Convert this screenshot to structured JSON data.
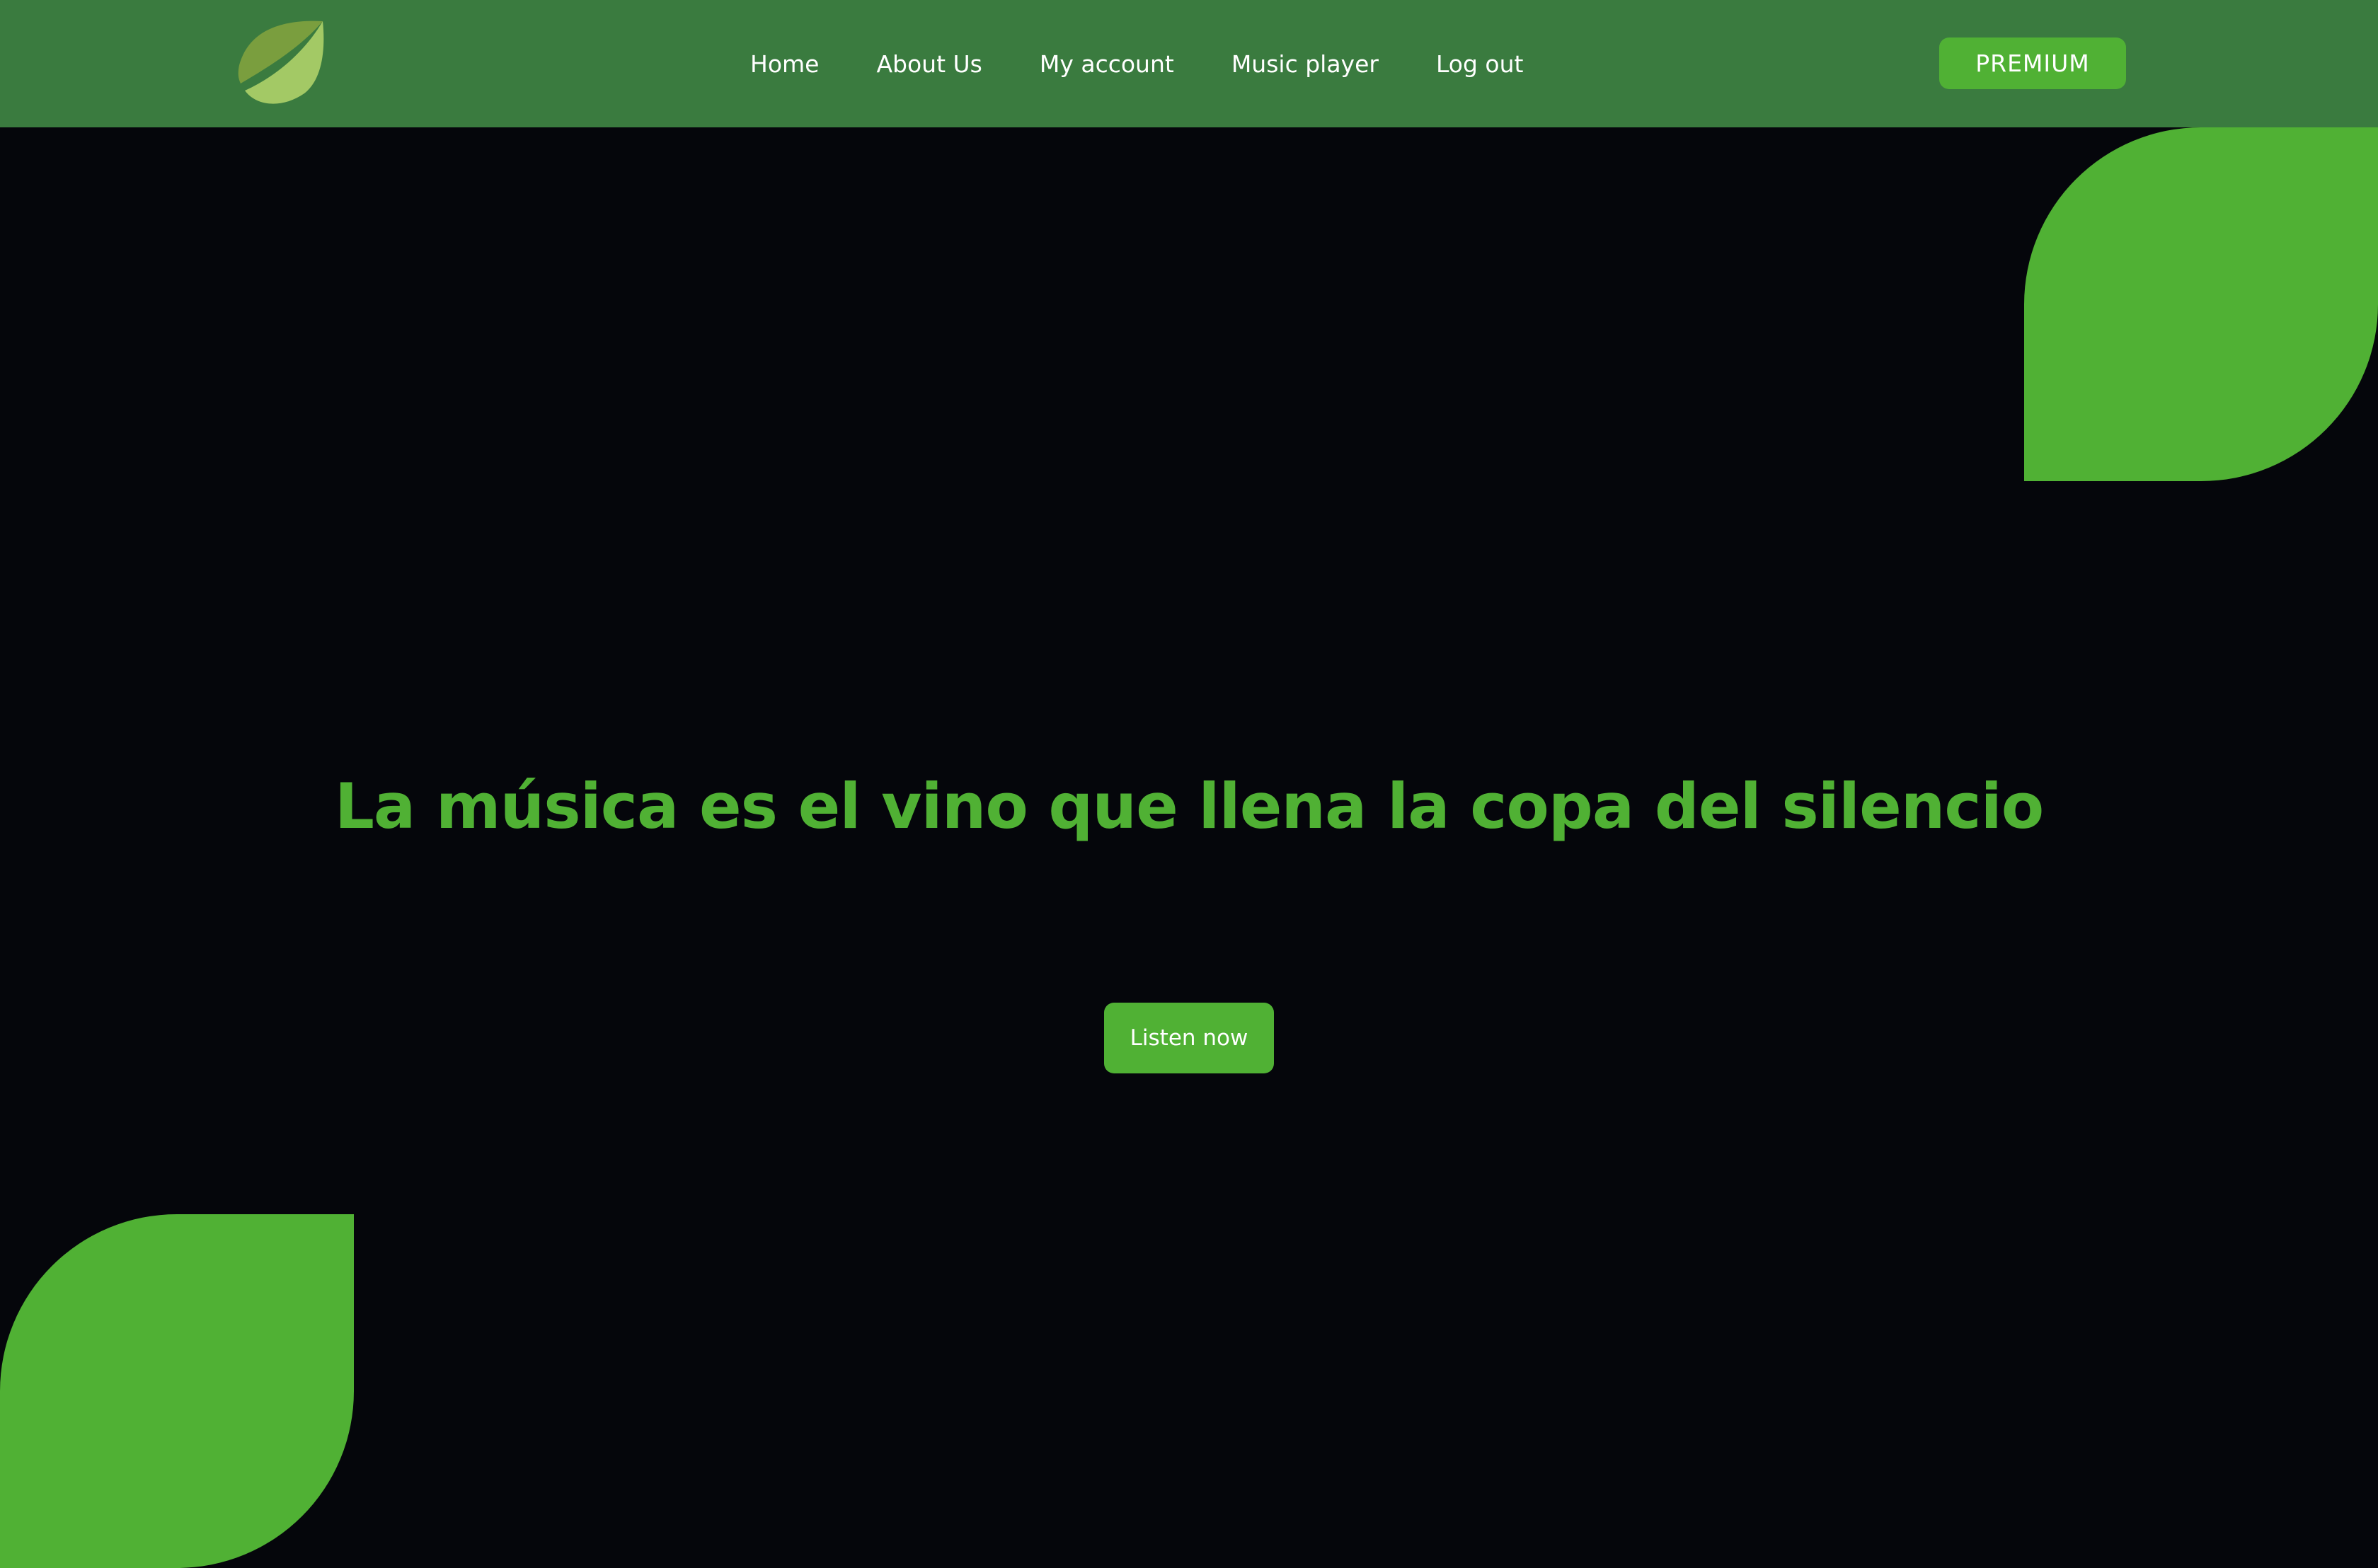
{
  "header": {
    "logo": {
      "icon": "leaf-icon",
      "colors": [
        "#7a9e3e",
        "#9fc766"
      ]
    },
    "nav": [
      {
        "label": "Home"
      },
      {
        "label": "About Us"
      },
      {
        "label": "My account"
      },
      {
        "label": "Music player"
      },
      {
        "label": "Log out"
      }
    ],
    "premium_label": "PREMIUM"
  },
  "hero": {
    "headline": "La música es el vino que llena la copa del silencio",
    "cta_label": "Listen now"
  },
  "colors": {
    "navbar": "#3a7b3f",
    "accent": "#50b134",
    "background": "#05060b",
    "text_light": "#ffffff"
  }
}
